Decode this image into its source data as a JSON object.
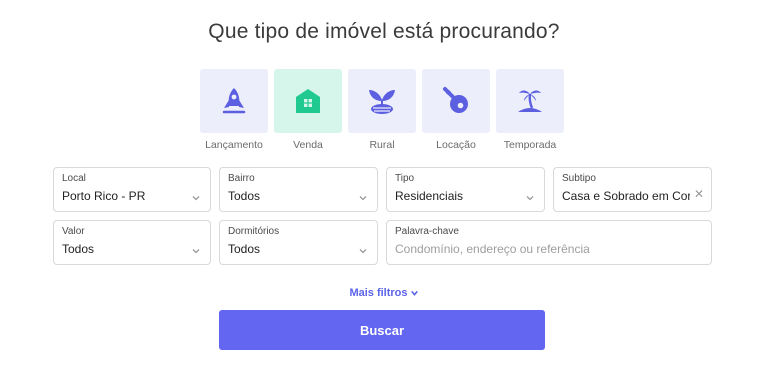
{
  "header": {
    "title": "Que tipo de imóvel está procurando?"
  },
  "types": [
    {
      "label": "Lançamento",
      "icon": "rocket-icon"
    },
    {
      "label": "Venda",
      "icon": "house-icon",
      "active": true
    },
    {
      "label": "Rural",
      "icon": "field-icon"
    },
    {
      "label": "Locação",
      "icon": "key-icon"
    },
    {
      "label": "Temporada",
      "icon": "palm-island-icon"
    }
  ],
  "filters": {
    "local": {
      "label": "Local",
      "value": "Porto Rico - PR"
    },
    "bairro": {
      "label": "Bairro",
      "value": "Todos"
    },
    "tipo": {
      "label": "Tipo",
      "value": "Residenciais"
    },
    "subtipo": {
      "label": "Subtipo",
      "value": "Casa e Sobrado em Cor"
    },
    "valor": {
      "label": "Valor",
      "value": "Todos"
    },
    "dormitorios": {
      "label": "Dormitórios",
      "value": "Todos"
    },
    "palavra": {
      "label": "Palavra-chave",
      "placeholder": "Condomínio, endereço ou referência"
    }
  },
  "actions": {
    "more_filters": "Mais filtros",
    "search": "Buscar"
  },
  "colors": {
    "accent": "#6366f1",
    "icon": "#5b5fe0",
    "active_icon": "#1fc98f",
    "tile": "#eceefb",
    "active_tile": "#d7f6eb"
  }
}
